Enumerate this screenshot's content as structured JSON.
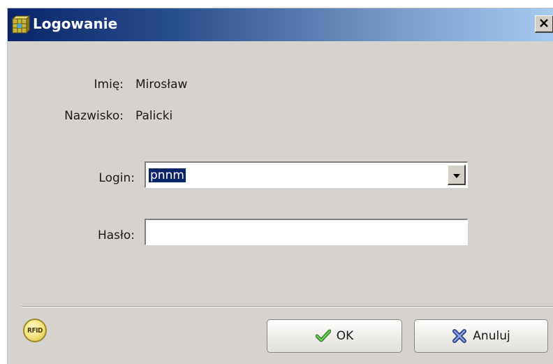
{
  "window": {
    "title": "Logowanie",
    "app_icon": "grid-app-icon",
    "close_label": "✕"
  },
  "info": {
    "first_name_label": "Imię:",
    "first_name_value": "Mirosław",
    "last_name_label": "Nazwisko:",
    "last_name_value": "Palicki"
  },
  "form": {
    "login_label": "Login:",
    "login_value": "pnnm",
    "password_label": "Hasło:",
    "password_value": ""
  },
  "footer": {
    "rfid_label": "RFID",
    "ok_label": "OK",
    "cancel_label": "Anuluj"
  },
  "colors": {
    "title_gradient_start": "#0a246a",
    "title_gradient_end": "#a6caf0",
    "dialog_bg": "#d6d3ce",
    "selection": "#0a246a",
    "ok_icon": "#3a9a2a",
    "cancel_icon": "#4a5fb0"
  }
}
